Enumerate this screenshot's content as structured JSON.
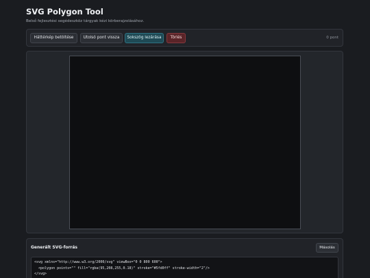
{
  "header": {
    "title": "SVG Polygon Tool",
    "subtitle": "Belső fejlesztési segédeszköz tárgyak kézi körberajzolásához."
  },
  "toolbar": {
    "load_background_label": "Háttérkép betöltése",
    "undo_last_point_label": "Utolsó pont vissza",
    "close_polygon_label": "Sokszög lezárása",
    "delete_label": "Törlés",
    "point_count": "0 pont"
  },
  "canvas": {
    "background_color": "#0e0f11",
    "points": []
  },
  "source": {
    "title": "Generált SVG-forrás",
    "copy_label": "Másolás",
    "code_lines": [
      "<svg xmlns=\"http://www.w3.org/2000/svg\" viewBox=\"0 0 800 600\">",
      "  <polygon points=\"\" fill=\"rgba(95,208,255,0.18)\" stroke=\"#5fd0ff\" stroke-width=\"2\"/>",
      "</svg>"
    ]
  },
  "colors": {
    "accent_close": "#1f4a55",
    "danger_delete": "#5a2428",
    "polygon_stroke": "#5fd0ff"
  }
}
